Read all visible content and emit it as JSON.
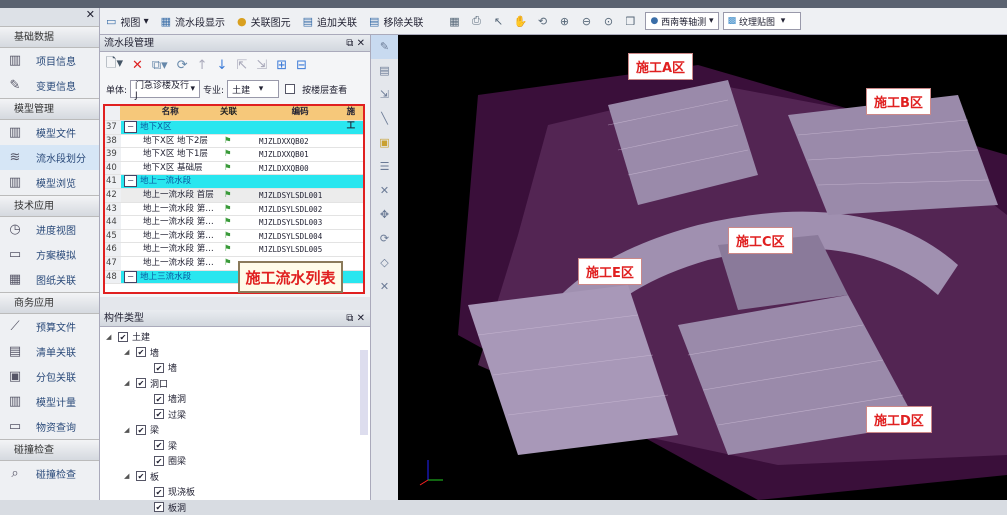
{
  "toolbar": {
    "view": "视图",
    "flow_display": "流水段显示",
    "link_elements": "关联图元",
    "add_link": "追加关联",
    "remove_link": "移除关联",
    "view_mode": "西南等轴测",
    "render_mode": "纹理贴图"
  },
  "sidebar": {
    "groups": [
      {
        "title": "基础数据",
        "items": [
          "项目信息",
          "变更信息"
        ]
      },
      {
        "title": "模型管理",
        "items": [
          "模型文件",
          "流水段划分",
          "模型浏览"
        ]
      },
      {
        "title": "技术应用",
        "items": [
          "进度视图",
          "方案模拟",
          "图纸关联"
        ]
      },
      {
        "title": "商务应用",
        "items": [
          "预算文件",
          "清单关联",
          "分包关联",
          "模型计量",
          "物资查询"
        ]
      },
      {
        "title": "碰撞检查",
        "items": [
          "碰撞检查"
        ]
      }
    ],
    "active": "流水段划分"
  },
  "flow_panel": {
    "title": "流水段管理",
    "unit_label": "单体:",
    "unit_value": "门急诊楼及行J",
    "discipline_label": "专业:",
    "discipline_value": "土建",
    "floor_check_label": "按楼层查看",
    "columns": [
      "名称",
      "关联",
      "编码",
      "施工"
    ],
    "rows": [
      {
        "n": "37",
        "name": "地下X区",
        "link": "",
        "code": "",
        "group": true
      },
      {
        "n": "38",
        "name": "地下X区 地下2层",
        "link": "⚑",
        "code": "MJZLDXXQB02"
      },
      {
        "n": "39",
        "name": "地下X区 地下1层",
        "link": "⚑",
        "code": "MJZLDXXQB01"
      },
      {
        "n": "40",
        "name": "地下X区 基础层",
        "link": "⚑",
        "code": "MJZLDXXQB00"
      },
      {
        "n": "41",
        "name": "地上一流水段",
        "link": "",
        "code": "",
        "group": true
      },
      {
        "n": "42",
        "name": "地上一流水段 首层",
        "link": "⚑",
        "code": "MJZLDSYLSDL001"
      },
      {
        "n": "43",
        "name": "地上一流水段 第…",
        "link": "⚑",
        "code": "MJZLDSYLSDL002"
      },
      {
        "n": "44",
        "name": "地上一流水段 第…",
        "link": "⚑",
        "code": "MJZLDSYLSDL003"
      },
      {
        "n": "45",
        "name": "地上一流水段 第…",
        "link": "⚑",
        "code": "MJZLDSYLSDL004"
      },
      {
        "n": "46",
        "name": "地上一流水段 第…",
        "link": "⚑",
        "code": "MJZLDSYLSDL005"
      },
      {
        "n": "47",
        "name": "地上一流水段 第…",
        "link": "⚑",
        "code": ""
      },
      {
        "n": "48",
        "name": "地上三流水段",
        "link": "",
        "code": "",
        "group": true
      }
    ],
    "callout": "施工流水列表"
  },
  "component_panel": {
    "title": "构件类型",
    "tree": [
      {
        "label": "土建",
        "level": 0
      },
      {
        "label": "墙",
        "level": 1
      },
      {
        "label": "墙",
        "level": 2
      },
      {
        "label": "洞口",
        "level": 1
      },
      {
        "label": "墙洞",
        "level": 2
      },
      {
        "label": "过梁",
        "level": 2
      },
      {
        "label": "梁",
        "level": 1
      },
      {
        "label": "梁",
        "level": 2
      },
      {
        "label": "圈梁",
        "level": 2
      },
      {
        "label": "板",
        "level": 1
      },
      {
        "label": "现浇板",
        "level": 2
      },
      {
        "label": "板洞",
        "level": 2
      }
    ]
  },
  "viewport": {
    "zones": [
      "施工A区",
      "施工B区",
      "施工C区",
      "施工E区",
      "施工D区"
    ]
  }
}
